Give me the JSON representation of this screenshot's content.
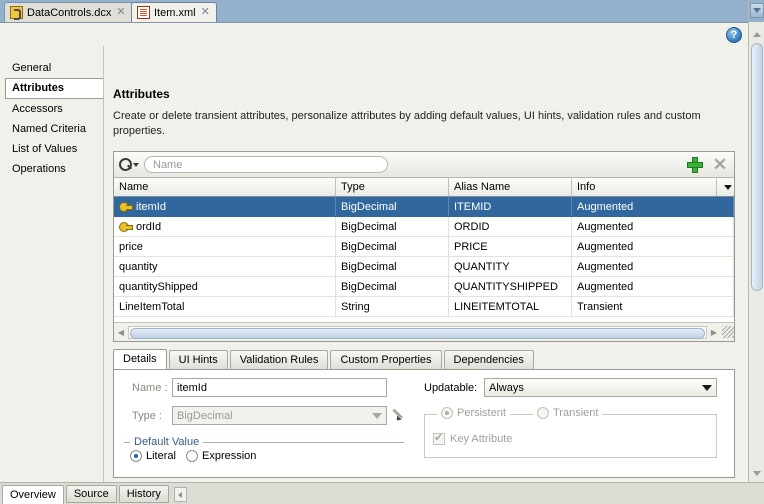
{
  "editor_tabs": [
    {
      "label": "DataControls.dcx",
      "icon": "dcx-file-icon",
      "close": "✕",
      "active": false
    },
    {
      "label": "Item.xml",
      "icon": "xml-file-icon",
      "close": "✕",
      "active": true
    }
  ],
  "help": {
    "icon": "help-question-icon",
    "glyph": "?"
  },
  "sidebar": {
    "items": [
      {
        "label": "General",
        "active": false
      },
      {
        "label": "Attributes",
        "active": true
      },
      {
        "label": "Accessors",
        "active": false
      },
      {
        "label": "Named Criteria",
        "active": false
      },
      {
        "label": "List of Values",
        "active": false
      },
      {
        "label": "Operations",
        "active": false
      }
    ]
  },
  "page": {
    "title": "Attributes",
    "description": "Create or delete transient attributes, personalize attributes by adding default values, UI hints, validation rules and custom properties."
  },
  "toolbar": {
    "search_icon": "search-magnifier-icon",
    "search_placeholder": "Name",
    "search_value": "",
    "add_label": "+",
    "add_title": "Add",
    "delete_label": "✕",
    "delete_title": "Delete"
  },
  "table": {
    "columns": [
      "Name",
      "Type",
      "Alias Name",
      "Info"
    ],
    "menu_icon": "column-menu-icon",
    "rows": [
      {
        "name": "itemId",
        "type": "BigDecimal",
        "alias": "ITEMID",
        "info": "Augmented",
        "key": true,
        "selected": true
      },
      {
        "name": "ordId",
        "type": "BigDecimal",
        "alias": "ORDID",
        "info": "Augmented",
        "key": true,
        "selected": false
      },
      {
        "name": "price",
        "type": "BigDecimal",
        "alias": "PRICE",
        "info": "Augmented",
        "key": false,
        "selected": false
      },
      {
        "name": "quantity",
        "type": "BigDecimal",
        "alias": "QUANTITY",
        "info": "Augmented",
        "key": false,
        "selected": false
      },
      {
        "name": "quantityShipped",
        "type": "BigDecimal",
        "alias": "QUANTITYSHIPPED",
        "info": "Augmented",
        "key": false,
        "selected": false
      },
      {
        "name": "LineItemTotal",
        "type": "String",
        "alias": "LINEITEMTOTAL",
        "info": "Transient",
        "key": false,
        "selected": false
      }
    ]
  },
  "detail_tabs": [
    {
      "label": "Details",
      "active": true
    },
    {
      "label": "UI Hints",
      "active": false
    },
    {
      "label": "Validation Rules",
      "active": false
    },
    {
      "label": "Custom Properties",
      "active": false
    },
    {
      "label": "Dependencies",
      "active": false
    }
  ],
  "details": {
    "name_label": "Name :",
    "name_value": "itemId",
    "type_label": "Type :",
    "type_value": "BigDecimal",
    "type_edit_icon": "pencil-edit-icon",
    "updatable_label": "Updatable:",
    "updatable_value": "Always",
    "persistence": {
      "persistent_label": "Persistent",
      "transient_label": "Transient",
      "selected": "Persistent",
      "key_attribute_label": "Key Attribute",
      "key_attribute_checked": true
    },
    "default_value": {
      "group_label": "Default Value",
      "literal_label": "Literal",
      "expression_label": "Expression",
      "selected": "Literal",
      "value": "",
      "edit_icon": "pencil-edit-icon"
    }
  },
  "bottom_tabs": [
    {
      "label": "Overview",
      "active": true
    },
    {
      "label": "Source",
      "active": false
    },
    {
      "label": "History",
      "active": false
    }
  ],
  "colors": {
    "header_blue": "#94b1cc",
    "selection_blue": "#31679c",
    "group_title_blue": "#3a5a86",
    "add_green": "#3ab03a",
    "key_gold": "#e8c22a"
  }
}
